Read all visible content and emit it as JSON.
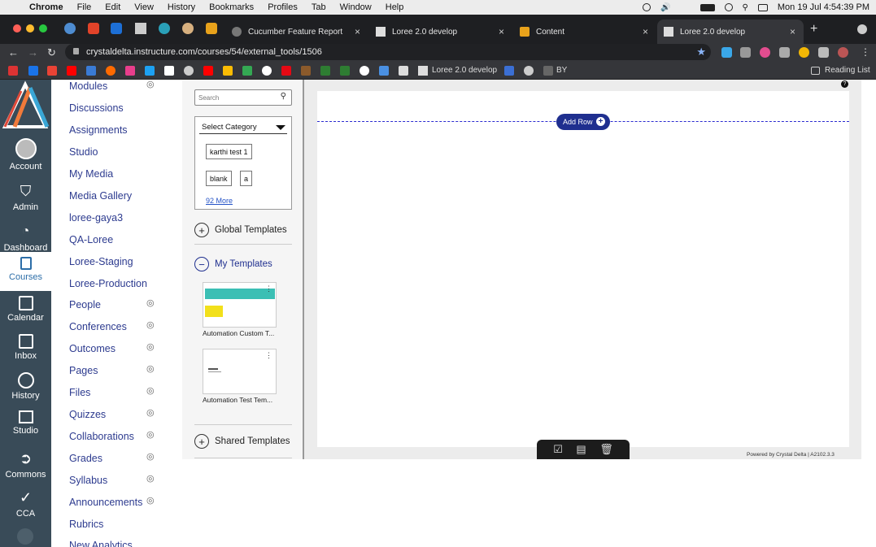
{
  "menubar": {
    "app": "Chrome",
    "items": [
      "File",
      "Edit",
      "View",
      "History",
      "Bookmarks",
      "Profiles",
      "Tab",
      "Window",
      "Help"
    ],
    "clock": "Mon 19 Jul  4:54:39 PM"
  },
  "tabs": [
    {
      "title": "Cucumber Feature Report"
    },
    {
      "title": "Loree 2.0 develop"
    },
    {
      "title": "Content"
    },
    {
      "title": "Loree 2.0 develop"
    }
  ],
  "address": {
    "url": "crystaldelta.instructure.com/courses/54/external_tools/1506"
  },
  "bookmarks": {
    "loree": "Loree 2.0 develop",
    "by": "BY",
    "reading_list": "Reading List"
  },
  "global_nav": {
    "account": "Account",
    "admin": "Admin",
    "dashboard": "Dashboard",
    "courses": "Courses",
    "calendar": "Calendar",
    "inbox": "Inbox",
    "history": "History",
    "studio": "Studio",
    "commons": "Commons",
    "cca": "CCA"
  },
  "course_nav": [
    "Modules",
    "Discussions",
    "Assignments",
    "Studio",
    "My Media",
    "Media Gallery",
    "loree-gaya3",
    "QA-Loree",
    "Loree-Staging",
    "Loree-Production",
    "People",
    "Conferences",
    "Outcomes",
    "Pages",
    "Files",
    "Quizzes",
    "Collaborations",
    "Grades",
    "Syllabus",
    "Announcements",
    "Rubrics",
    "New Analytics"
  ],
  "side_panel": {
    "search_placeholder": "Search",
    "category_label": "Select Category",
    "chips": [
      "karthi test 1",
      "blank",
      "a"
    ],
    "more": "92 More",
    "global_templates": "Global Templates",
    "my_templates": "My Templates",
    "template1": "Automation Custom T...",
    "template2": "Automation Test Tem...",
    "shared_templates": "Shared Templates"
  },
  "editor": {
    "add_row": "Add Row",
    "footer": "Powered by Crystal Delta   |   A2102.3.3",
    "help": "?"
  },
  "colors": {
    "brand_nav": "#394b58",
    "link": "#2d3b8f",
    "accent": "#1f2f8f"
  }
}
